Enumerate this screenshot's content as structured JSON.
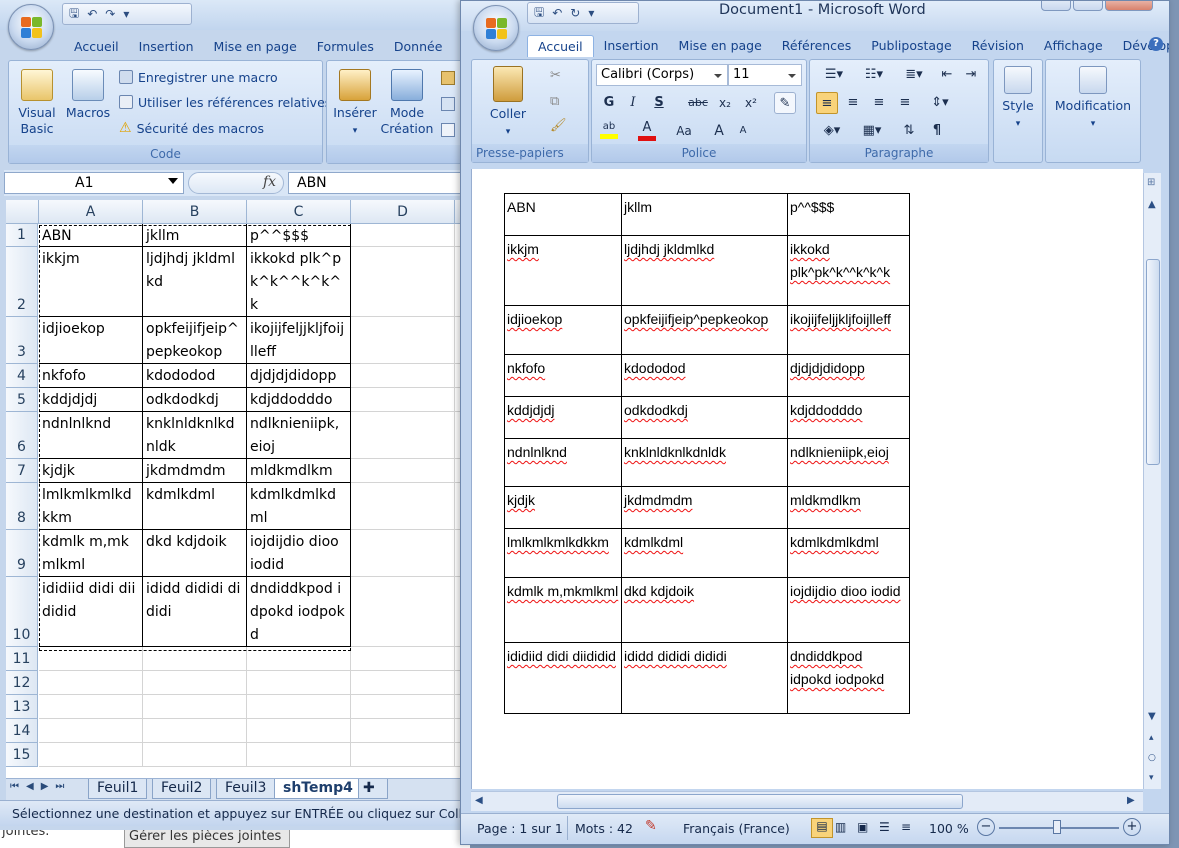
{
  "background": {
    "partial_text": "jointes.",
    "button_label": "Gérer les pièces jointes"
  },
  "excel": {
    "ribbon_tabs": [
      "Accueil",
      "Insertion",
      "Mise en page",
      "Formules",
      "Donnée"
    ],
    "code_group": {
      "visual_basic": "Visual Basic",
      "macros": "Macros",
      "record_macro": "Enregistrer une macro",
      "relative_refs": "Utiliser les références relatives",
      "macro_security": "Sécurité des macros",
      "label": "Code"
    },
    "controls_group": {
      "insert": "Insérer",
      "design_mode": "Mode Création"
    },
    "name_box": "A1",
    "fx": "fx",
    "formula": "ABN",
    "columns": [
      "A",
      "B",
      "C",
      "D"
    ],
    "rows": [
      "1",
      "2",
      "3",
      "4",
      "5",
      "6",
      "7",
      "8",
      "9",
      "10",
      "11",
      "12",
      "13",
      "14",
      "15"
    ],
    "cells": [
      [
        "ABN",
        "jkllm",
        "p^^$$$"
      ],
      [
        "ikkjm",
        "ljdjhdj jkldmlkd",
        "ikkokd plk^pk^k^^k^k^k"
      ],
      [
        "idjioekop",
        "opkfeijifjeip^pepkeokop",
        "ikojijfeljjkljfoijlleff"
      ],
      [
        "nkfofo",
        "kdododod",
        "djdjdjdidopp"
      ],
      [
        "kddjdjdj",
        "odkdodkdj",
        "kdjddodddo"
      ],
      [
        "ndnlnlknd",
        "knklnldknlkdnldk",
        "ndlknieniipk,eioj"
      ],
      [
        "kjdjk",
        "jkdmdmdm",
        "mldkmdlkm"
      ],
      [
        "lmlkmlkmlkdkkm",
        "kdmlkdml",
        "kdmlkdmlkdml"
      ],
      [
        "kdmlk m,mkmlkml",
        "dkd kdjdoik",
        "iojdijdio dioo iodid"
      ],
      [
        "ididiid didi diididid",
        "ididd dididi dididi",
        "dndiddkpod idpokd iodpokd"
      ]
    ],
    "sheet_tabs": [
      "Feuil1",
      "Feuil2",
      "Feuil3",
      "shTemp4"
    ],
    "active_sheet": "shTemp4",
    "status": "Sélectionnez une destination et appuyez sur ENTRÉE ou cliquez sur Coller"
  },
  "word": {
    "title": "Document1 - Microsoft Word",
    "ribbon_tabs": [
      "Accueil",
      "Insertion",
      "Mise en page",
      "Références",
      "Publipostage",
      "Révision",
      "Affichage",
      "Développeur"
    ],
    "active_tab": "Accueil",
    "font_name": "Calibri (Corps)",
    "font_size": "11",
    "paste": "Coller",
    "style": "Style",
    "modification": "Modification",
    "group_labels": [
      "Presse-papiers",
      "Police",
      "Paragraphe"
    ],
    "bold": "G",
    "italic": "I",
    "underline": "S",
    "strike": "abc",
    "sub": "x₂",
    "sup": "x²",
    "change_case": "Aa",
    "grow": "A",
    "shrink": "A",
    "pilcrow": "¶",
    "table": [
      [
        "ABN",
        "jkllm",
        "p^^$$$"
      ],
      [
        "ikkjm",
        "ljdjhdj jkldmlkd",
        "ikkokd plk^pk^k^^k^k^k"
      ],
      [
        "idjioekop",
        "opkfeijifjeip^pepkeokop",
        "ikojijfeljjkljfoijlleff"
      ],
      [
        "nkfofo",
        "kdododod",
        "djdjdjdidopp"
      ],
      [
        "kddjdjdj",
        "odkdodkdj",
        "kdjddodddo"
      ],
      [
        "ndnlnlknd",
        "knklnldknlkdnldk",
        "ndlknieniipk,eioj"
      ],
      [
        "kjdjk",
        "jkdmdmdm",
        "mldkmdlkm"
      ],
      [
        "lmlkmlkmlkdkkm",
        "kdmlkdml",
        "kdmlkdmlkdml"
      ],
      [
        "kdmlk m,mkmlkml",
        "dkd kdjdoik",
        "iojdijdio dioo iodid"
      ],
      [
        "ididiid didi diididid",
        "ididd dididi dididi",
        "dndiddkpod idpokd iodpokd"
      ]
    ],
    "status": {
      "page": "Page : 1 sur 1",
      "words": "Mots : 42",
      "language": "Français (France)",
      "zoom": "100 %"
    }
  },
  "colors": {
    "ribbon_blue": "#c5d6ec",
    "accent_text": "#15428b",
    "spellcheck": "#ee1111"
  }
}
